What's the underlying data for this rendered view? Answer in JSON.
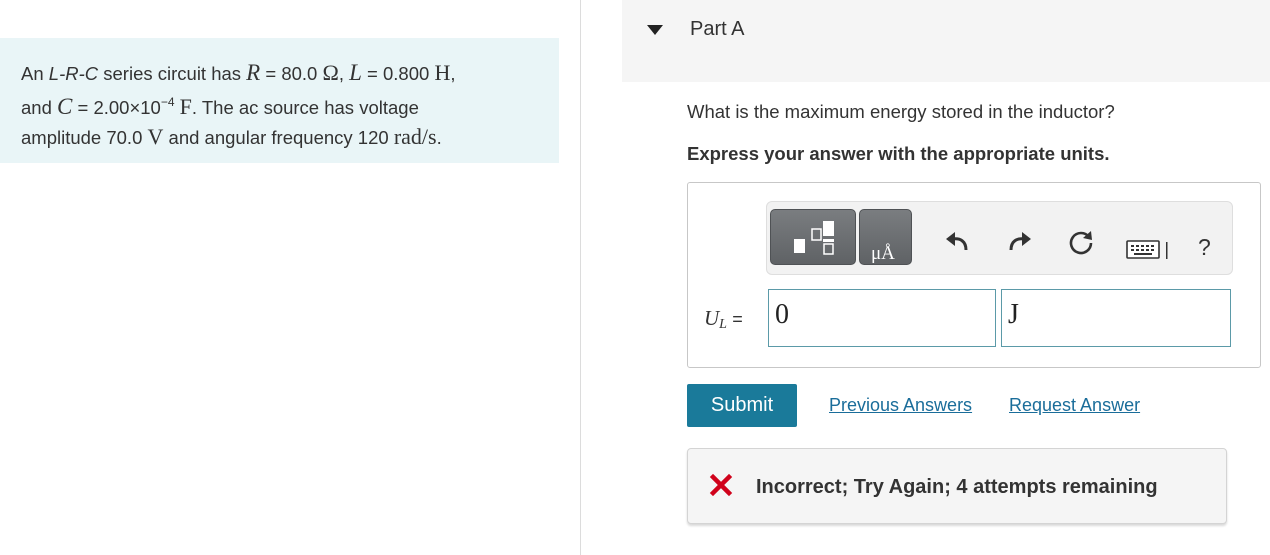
{
  "problem": {
    "intro": "An",
    "circuit_type": "L-R-C",
    "text1": "series circuit has",
    "R_symbol": "R",
    "R_value": "= 80.0",
    "R_unit": "Ω",
    "L_symbol": "L",
    "L_value": "= 0.800",
    "L_unit": "H",
    "and": "and",
    "C_symbol": "C",
    "C_value": "= 2.00×10",
    "C_exponent": "−4",
    "C_unit": "F",
    "text2": ". The ac source has voltage",
    "text3": "amplitude 70.0",
    "V_unit": "V",
    "text4": "and angular frequency 120",
    "omega_unit": "rad/s"
  },
  "part": {
    "title": "Part A",
    "question": "What is the maximum energy stored in the inductor?",
    "instruction": "Express your answer with the appropriate units."
  },
  "toolbar": {
    "units_glyph": "μÅ",
    "help": "?"
  },
  "answer": {
    "variable": "U",
    "subscript": "L",
    "equals": "=",
    "value": "0",
    "units": "J"
  },
  "actions": {
    "submit": "Submit",
    "previous_answers": "Previous Answers",
    "request_answer": "Request Answer"
  },
  "feedback": {
    "message": "Incorrect; Try Again; 4 attempts remaining",
    "color": "#d0021b"
  },
  "colors": {
    "problem_bg": "#e9f5f7",
    "accent": "#1a7a9a",
    "link": "#1a6d9a"
  }
}
